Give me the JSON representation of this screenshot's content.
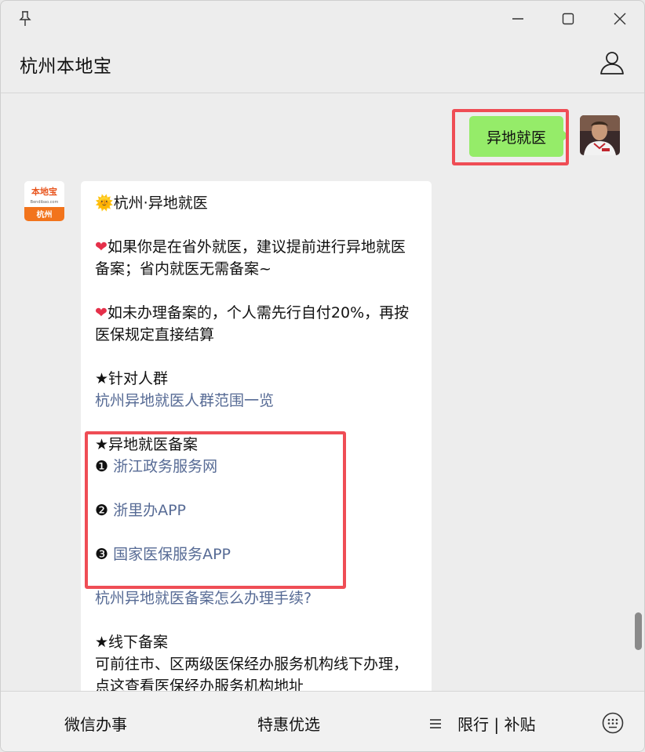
{
  "window": {
    "icons": {
      "pin": "pin-icon",
      "minimize": "minimize-icon",
      "maximize": "maximize-icon",
      "close": "close-icon"
    }
  },
  "header": {
    "title": "杭州本地宝",
    "profile_icon": "person-icon"
  },
  "chat": {
    "user_message": "异地就医",
    "bot": {
      "avatar_text_top": "本地宝",
      "avatar_site": "Bendibao.com",
      "avatar_city": "杭州",
      "headline_emoji": "🌞",
      "headline": "杭州·异地就医",
      "note1": "如果你是在省外就医，建议提前进行异地就医备案；省内就医无需备案~",
      "note2": "如未办理备案的，个人需先行自付20%，再按医保规定直接结算",
      "section_people": "★针对人群",
      "link_people": "杭州异地就医人群范围一览",
      "section_filing": "★异地就医备案",
      "filing_items": [
        {
          "num": "❶",
          "label": "浙江政务服务网"
        },
        {
          "num": "❷",
          "label": "浙里办APP"
        },
        {
          "num": "❸",
          "label": "国家医保服务APP"
        }
      ],
      "link_procedure": "杭州异地就医备案怎么办理手续?",
      "section_offline": "★线下备案",
      "offline_text": "可前往市、区两级医保经办服务机构线下办理，点这查看医保经办服务机构地址"
    }
  },
  "bottom_menu": {
    "items": [
      "微信办事",
      "特惠优选",
      "限行 | 补贴"
    ],
    "keyboard_icon": "keyboard-icon"
  },
  "colors": {
    "user_bubble": "#95ec69",
    "link": "#576b95",
    "highlight": "#ef4d55"
  }
}
